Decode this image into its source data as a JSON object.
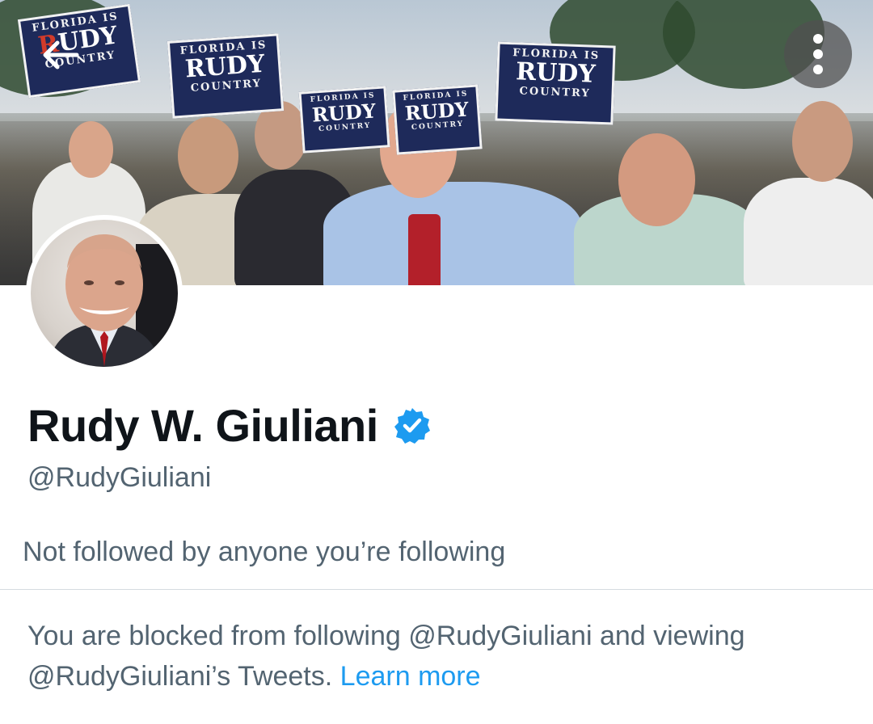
{
  "banner": {
    "signs": [
      {
        "top": "FLORIDA IS",
        "mid_a": "R",
        "mid_b": "UDY",
        "bot": "COUNTRY"
      },
      {
        "top": "FLORIDA IS",
        "mid_a": "RUDY",
        "mid_b": "",
        "bot": "COUNTRY"
      },
      {
        "top": "FLORIDA IS",
        "mid_a": "RUDY",
        "mid_b": "",
        "bot": "COUNTRY"
      },
      {
        "top": "FLORIDA IS",
        "mid_a": "RUDY",
        "mid_b": "",
        "bot": "COUNTRY"
      },
      {
        "top": "FLORIDA IS",
        "mid_a": "RUDY",
        "mid_b": "",
        "bot": "COUNTRY"
      }
    ]
  },
  "icons": {
    "back": "arrow-left-icon",
    "more": "more-vertical-icon",
    "verified": "verified-badge-icon"
  },
  "colors": {
    "verified": "#1d9bf0",
    "link": "#1d9bf0",
    "secondary_text": "#536471",
    "primary_text": "#0f1419"
  },
  "profile": {
    "name": "Rudy W. Giuliani",
    "handle": "@RudyGiuliani",
    "followed_by_note": "Not followed by anyone you’re following"
  },
  "blocked_notice": {
    "text": "You are blocked from following @RudyGiuliani and viewing @RudyGiuliani’s Tweets.",
    "link_label": "Learn more"
  }
}
